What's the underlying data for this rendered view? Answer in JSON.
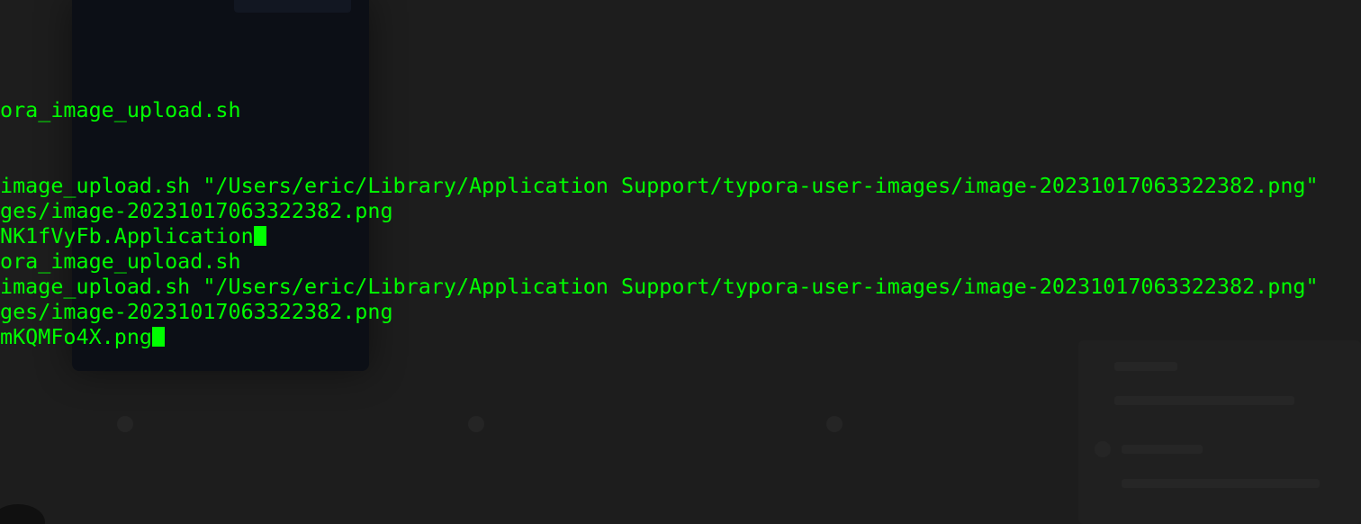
{
  "terminal": {
    "lines": [
      "ora_image_upload.sh",
      "image_upload.sh \"/Users/eric/Library/Application Support/typora-user-images/image-20231017063322382.png\"",
      "ges/image-20231017063322382.png",
      "NK1fVyFb.Application",
      "ora_image_upload.sh",
      "image_upload.sh \"/Users/eric/Library/Application Support/typora-user-images/image-20231017063322382.png\"",
      "ges/image-20231017063322382.png",
      "mKQMFo4X.png"
    ]
  },
  "colors": {
    "text": "#00ff00",
    "background": "#1d1d1d"
  }
}
